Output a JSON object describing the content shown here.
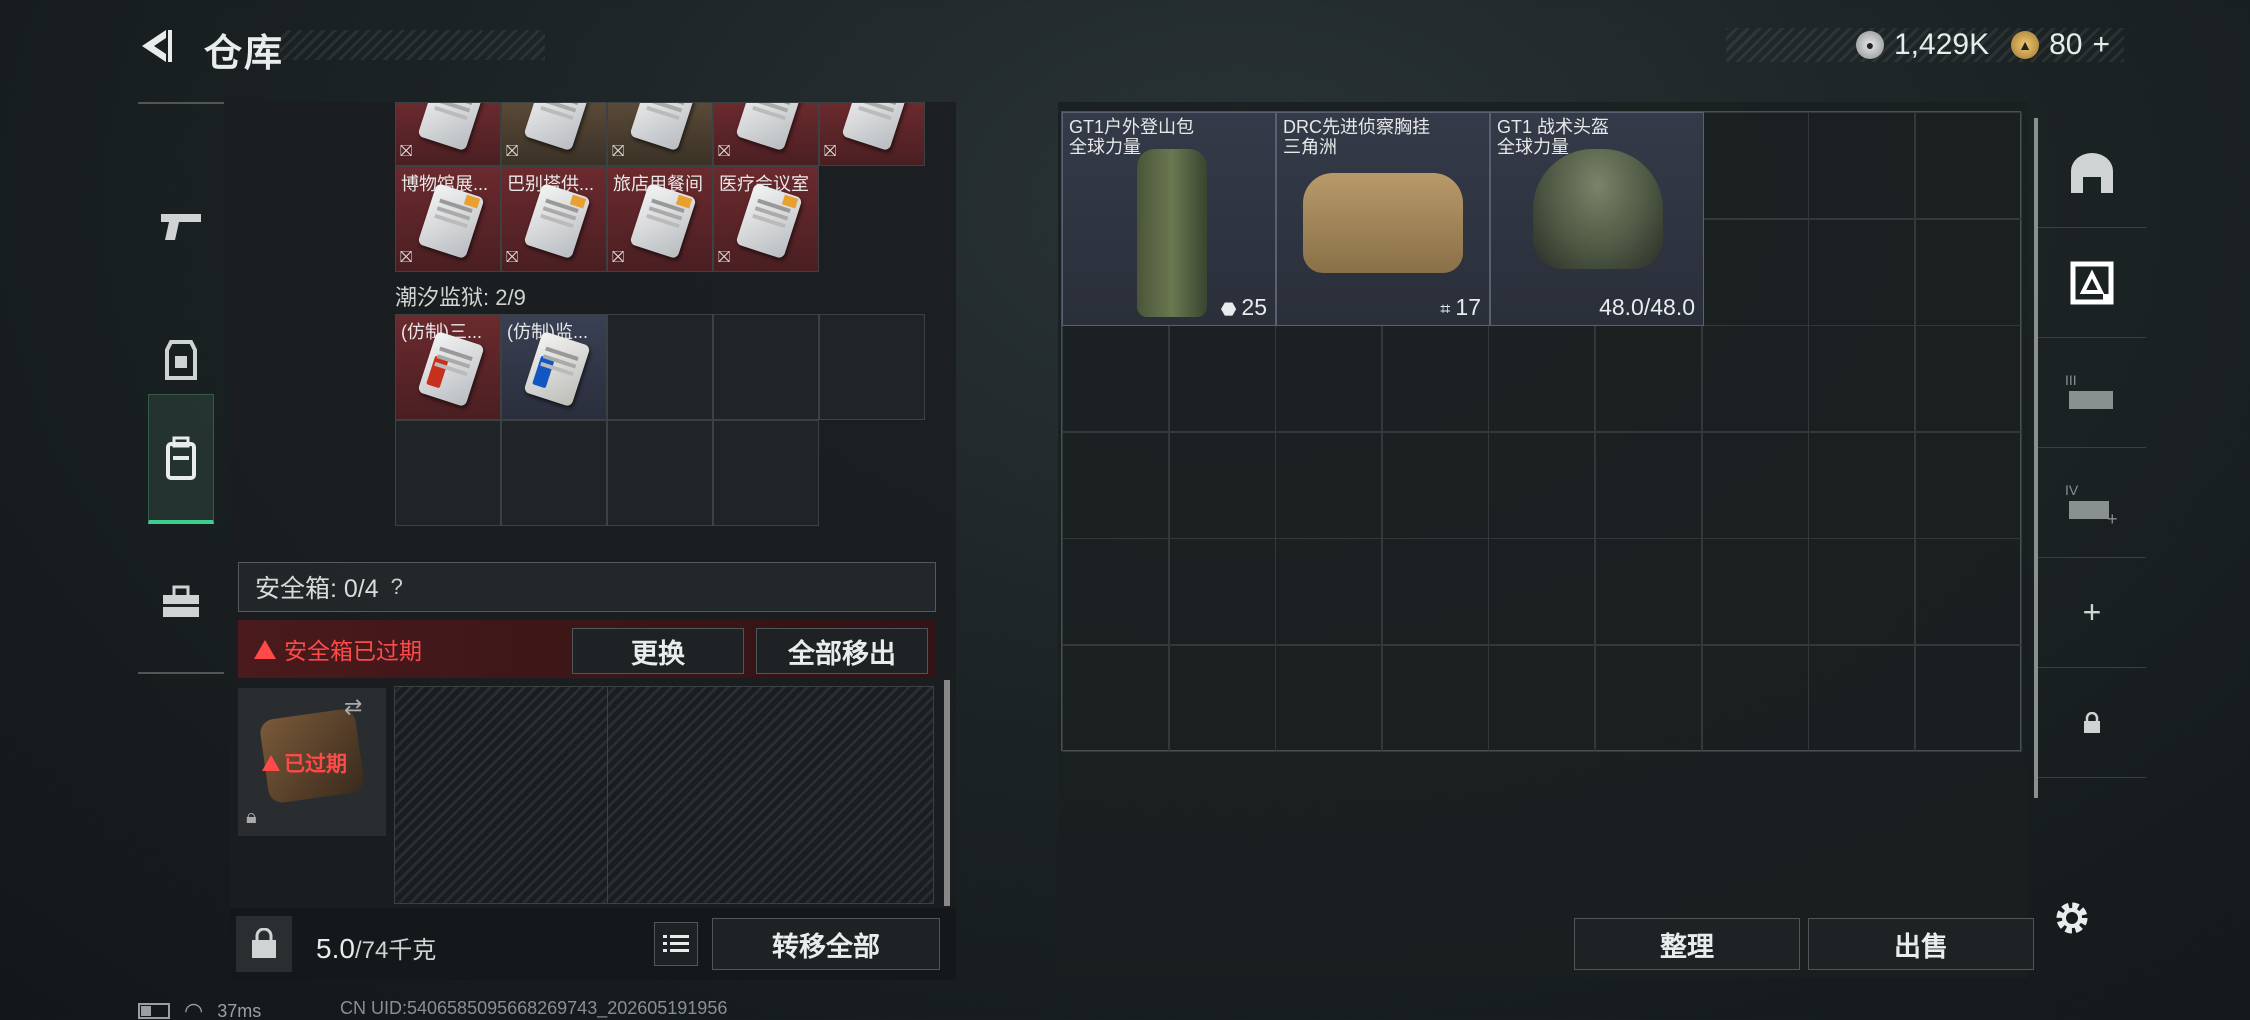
{
  "header": {
    "title": "仓库",
    "currencies": [
      {
        "icon": "silver-coin-icon",
        "value": "1,429K"
      },
      {
        "icon": "gold-coin-icon",
        "value": "80"
      }
    ],
    "add_symbol": "+"
  },
  "categories": [
    {
      "icon": "pistol-icon",
      "active": false
    },
    {
      "icon": "armor-vest-icon",
      "active": false
    },
    {
      "icon": "backpack-icon",
      "active": true
    },
    {
      "icon": "toolbox-icon",
      "active": false
    }
  ],
  "keycards": {
    "top_row_partial": [
      "",
      "",
      "",
      "",
      ""
    ],
    "row2": [
      "博物馆展...",
      "巴别塔供...",
      "旅店用餐间",
      "医疗会议室"
    ],
    "region_label": "潮汐监狱: 2/9",
    "region_row": [
      "(仿制)三...",
      "(仿制)监..."
    ]
  },
  "safebox": {
    "label": "安全箱: 0/4",
    "help": "?",
    "expired_text": "安全箱已过期",
    "replace_button": "更换",
    "remove_all_button": "全部移出",
    "item_expired_tag": "已过期"
  },
  "bottom_left": {
    "weight": "5.0",
    "weight_max": "/74千克",
    "transfer_all_button": "转移全部"
  },
  "stash": {
    "items": [
      {
        "name": "GT1户外登山包",
        "sub": "全球力量",
        "qty": "25",
        "qty_icon": "capacity-icon"
      },
      {
        "name": "DRC先进侦察胸挂",
        "sub": "三角洲",
        "qty": "17",
        "qty_icon": "rig-slots-icon"
      },
      {
        "name": "GT1 战术头盔",
        "sub": "全球力量",
        "qty": "48.0/48.0",
        "qty_icon": ""
      }
    ],
    "sort_button": "整理",
    "sell_button": "出售"
  },
  "right_sidebar": [
    "arch-icon",
    "stash-tab-icon",
    "stash-tab-3-icon",
    "stash-tab-4-icon",
    "plus-icon",
    "lock-icon"
  ],
  "status": {
    "ping": "37ms",
    "uid": "CN UID:5406585095668269743_202605191956"
  },
  "colors": {
    "accent_green": "#3ecf8e",
    "warning_red": "#ff4a4a",
    "card_red": "#6b2a2e"
  }
}
